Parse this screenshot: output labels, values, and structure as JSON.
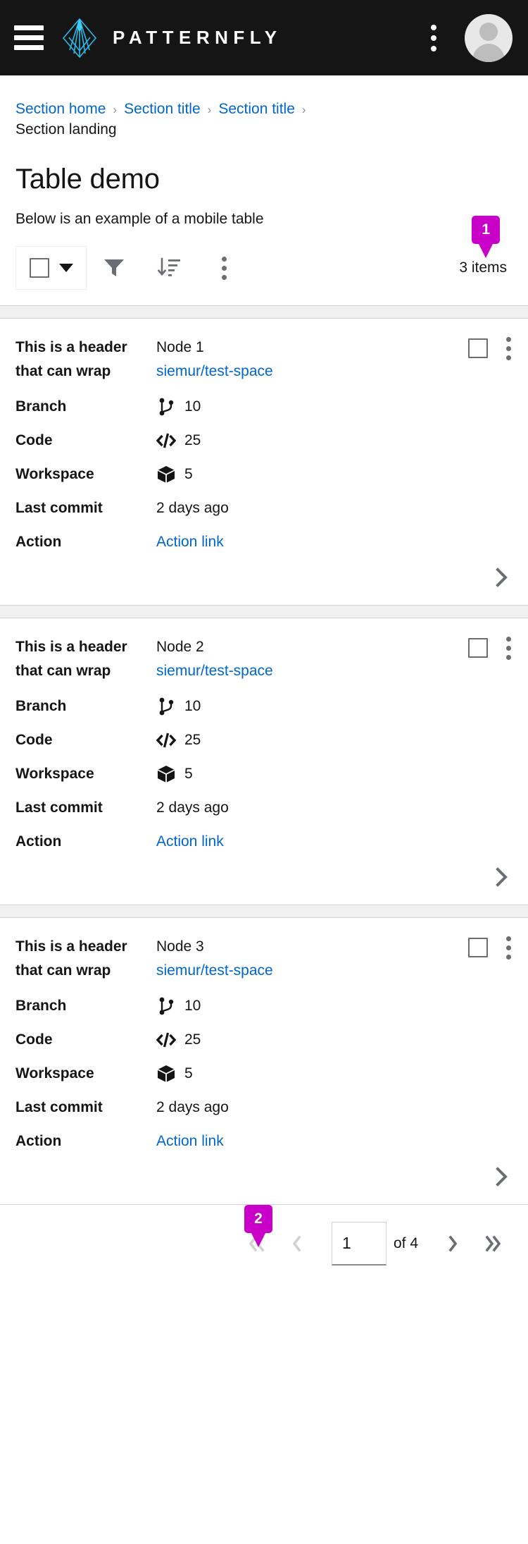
{
  "masthead": {
    "hamburger_icon": "hamburger-menu-icon",
    "logo_icon": "patternfly-logo-icon",
    "brand_name": "PATTERNFLY",
    "kebab_icon": "ellipsis-vertical-icon",
    "avatar_icon": "user-avatar-icon"
  },
  "breadcrumb": {
    "items": [
      {
        "label": "Section home",
        "link": true
      },
      {
        "label": "Section title",
        "link": true
      },
      {
        "label": "Section title",
        "link": true
      },
      {
        "label": "Section landing",
        "link": false
      }
    ],
    "separator": "›"
  },
  "page": {
    "title": "Table demo",
    "subtitle": "Below is an example of a mobile table"
  },
  "toolbar": {
    "bulk_select_label": "bulk-select-checkbox",
    "filter_icon": "filter-funnel-icon",
    "sort_icon": "sort-amount-down-icon",
    "kebab_icon": "ellipsis-vertical-icon",
    "items_count": "3 items"
  },
  "annotations": [
    {
      "id": "1",
      "label": "1",
      "target": "items-count",
      "color": "#c800c8"
    },
    {
      "id": "2",
      "label": "2",
      "target": "pagination-page-input",
      "color": "#c800c8"
    }
  ],
  "table": {
    "column_labels": {
      "header": "This is a header that can wrap",
      "branch": "Branch",
      "code": "Code",
      "workspace": "Workspace",
      "last_commit": "Last commit",
      "action": "Action"
    },
    "rows": [
      {
        "header": "This is a header that can wrap",
        "node": "Node 1",
        "repo": "siemur/test-space",
        "branch": "10",
        "code": "25",
        "workspace": "5",
        "last_commit": "2 days ago",
        "action": "Action link"
      },
      {
        "header": "This is a header that can wrap",
        "node": "Node 2",
        "repo": "siemur/test-space",
        "branch": "10",
        "code": "25",
        "workspace": "5",
        "last_commit": "2 days ago",
        "action": "Action link"
      },
      {
        "header": "This is a header that can wrap",
        "node": "Node 3",
        "repo": "siemur/test-space",
        "branch": "10",
        "code": "25",
        "workspace": "5",
        "last_commit": "2 days ago",
        "action": "Action link"
      }
    ]
  },
  "pagination": {
    "first_icon": "angle-double-left-icon",
    "prev_icon": "angle-left-icon",
    "page_value": "1",
    "of_label": "of 4",
    "next_icon": "angle-right-icon",
    "last_icon": "angle-double-right-icon"
  },
  "colors": {
    "masthead_bg": "#151515",
    "link": "#0066cc",
    "accent_badge": "#c800c8",
    "row_separator": "#f0f0f0",
    "border": "#d2d2d2"
  }
}
